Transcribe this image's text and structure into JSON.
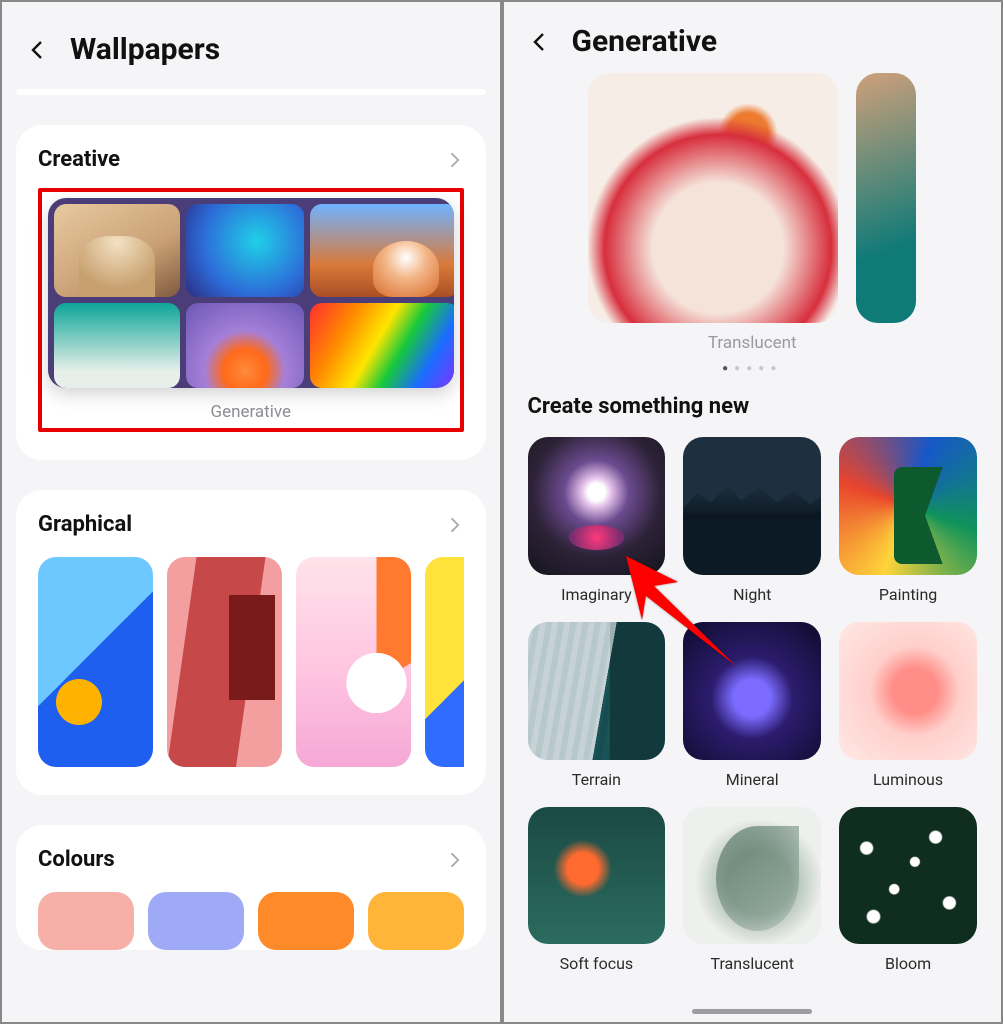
{
  "left": {
    "title": "Wallpapers",
    "sections": {
      "creative": {
        "title": "Creative",
        "generative_caption": "Generative"
      },
      "graphical": {
        "title": "Graphical"
      },
      "colours": {
        "title": "Colours",
        "swatches": [
          "#f6b0a7",
          "#9faaf6",
          "#ff8a2a",
          "#ffb43a"
        ]
      }
    }
  },
  "right": {
    "title": "Generative",
    "preview_caption": "Translucent",
    "pager": {
      "count": 5,
      "active": 0
    },
    "subheading": "Create something new",
    "themes": [
      {
        "id": "imaginary",
        "label": "Imaginary",
        "thumb": "t-imaginary"
      },
      {
        "id": "night",
        "label": "Night",
        "thumb": "t-night"
      },
      {
        "id": "painting",
        "label": "Painting",
        "thumb": "t-painting"
      },
      {
        "id": "terrain",
        "label": "Terrain",
        "thumb": "t-terrain"
      },
      {
        "id": "mineral",
        "label": "Mineral",
        "thumb": "t-mineral"
      },
      {
        "id": "luminous",
        "label": "Luminous",
        "thumb": "t-luminous"
      },
      {
        "id": "softfocus",
        "label": "Soft focus",
        "thumb": "t-soft"
      },
      {
        "id": "translucent",
        "label": "Translucent",
        "thumb": "t-trans"
      },
      {
        "id": "bloom",
        "label": "Bloom",
        "thumb": "t-bloom"
      }
    ]
  },
  "annotation": {
    "highlight": "generative-tile",
    "arrow_to": "imaginary"
  }
}
